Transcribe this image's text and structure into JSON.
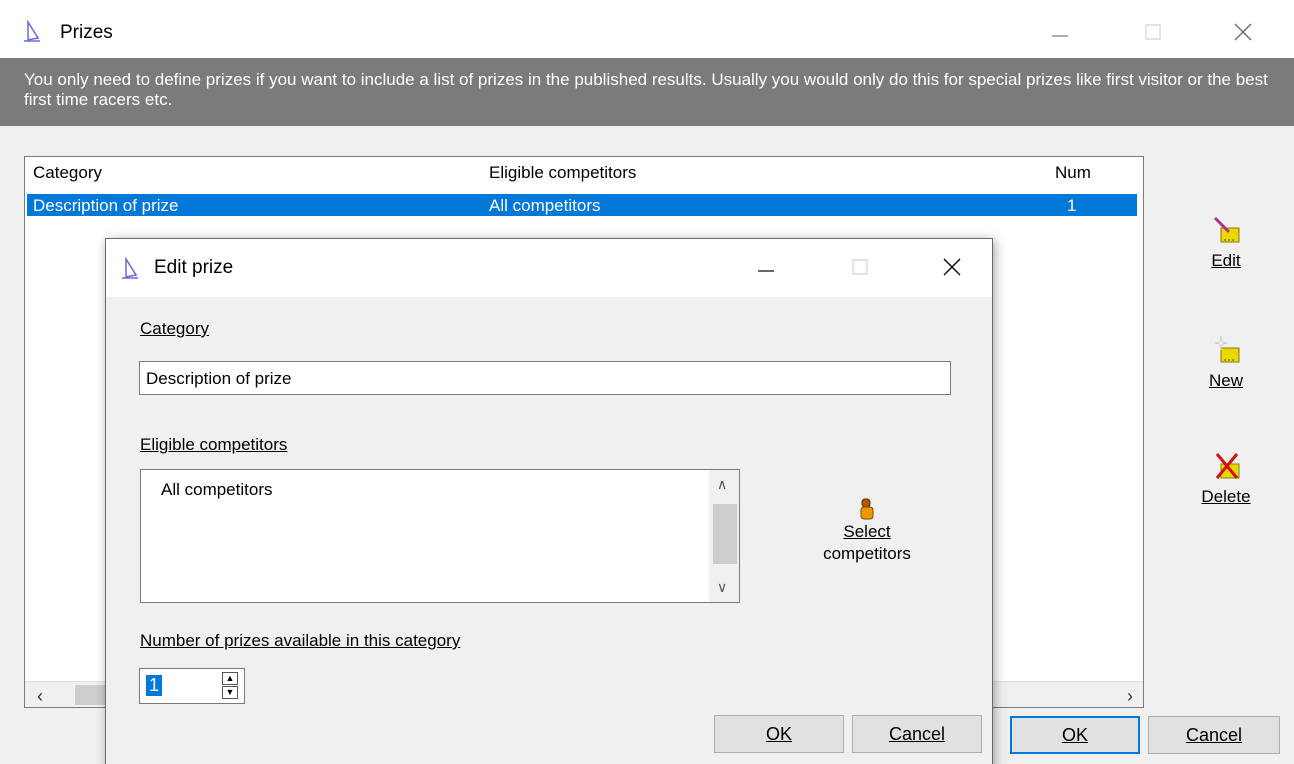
{
  "window": {
    "title": "Prizes",
    "info_text": "You only need to define prizes if you  want to include a list of prizes in the published results.  Usually you would only do this for special prizes like first visitor or the best first time racers etc."
  },
  "list": {
    "columns": [
      "Category",
      "Eligible competitors",
      "Num"
    ],
    "rows": [
      {
        "category": "Description of prize",
        "eligible": "All competitors",
        "num": "1",
        "selected": true
      }
    ]
  },
  "side_buttons": {
    "edit_label": "Edit",
    "new_label": "New",
    "delete_label": "Delete"
  },
  "outer_buttons": {
    "ok_label": "OK",
    "cancel_label": "Cancel"
  },
  "dialog": {
    "title": "Edit prize",
    "category_label": "Category",
    "category_value": "Description of prize",
    "eligible_label": "Eligible competitors",
    "eligible_value": "All competitors",
    "select_label_line1": "Select",
    "select_label_line2": "competitors",
    "number_label": "Number of prizes available in this category",
    "number_value": "1",
    "ok_label": "OK",
    "cancel_label": "Cancel"
  },
  "colors": {
    "selection": "#0078d7",
    "info_bar": "#7b7b7b",
    "window_bg": "#f0f0f0"
  },
  "icons": [
    "sailboat-app-icon",
    "minimize-icon",
    "maximize-icon",
    "close-icon",
    "edit-pencil-icon",
    "new-star-icon",
    "delete-x-icon",
    "select-competitors-icon"
  ]
}
